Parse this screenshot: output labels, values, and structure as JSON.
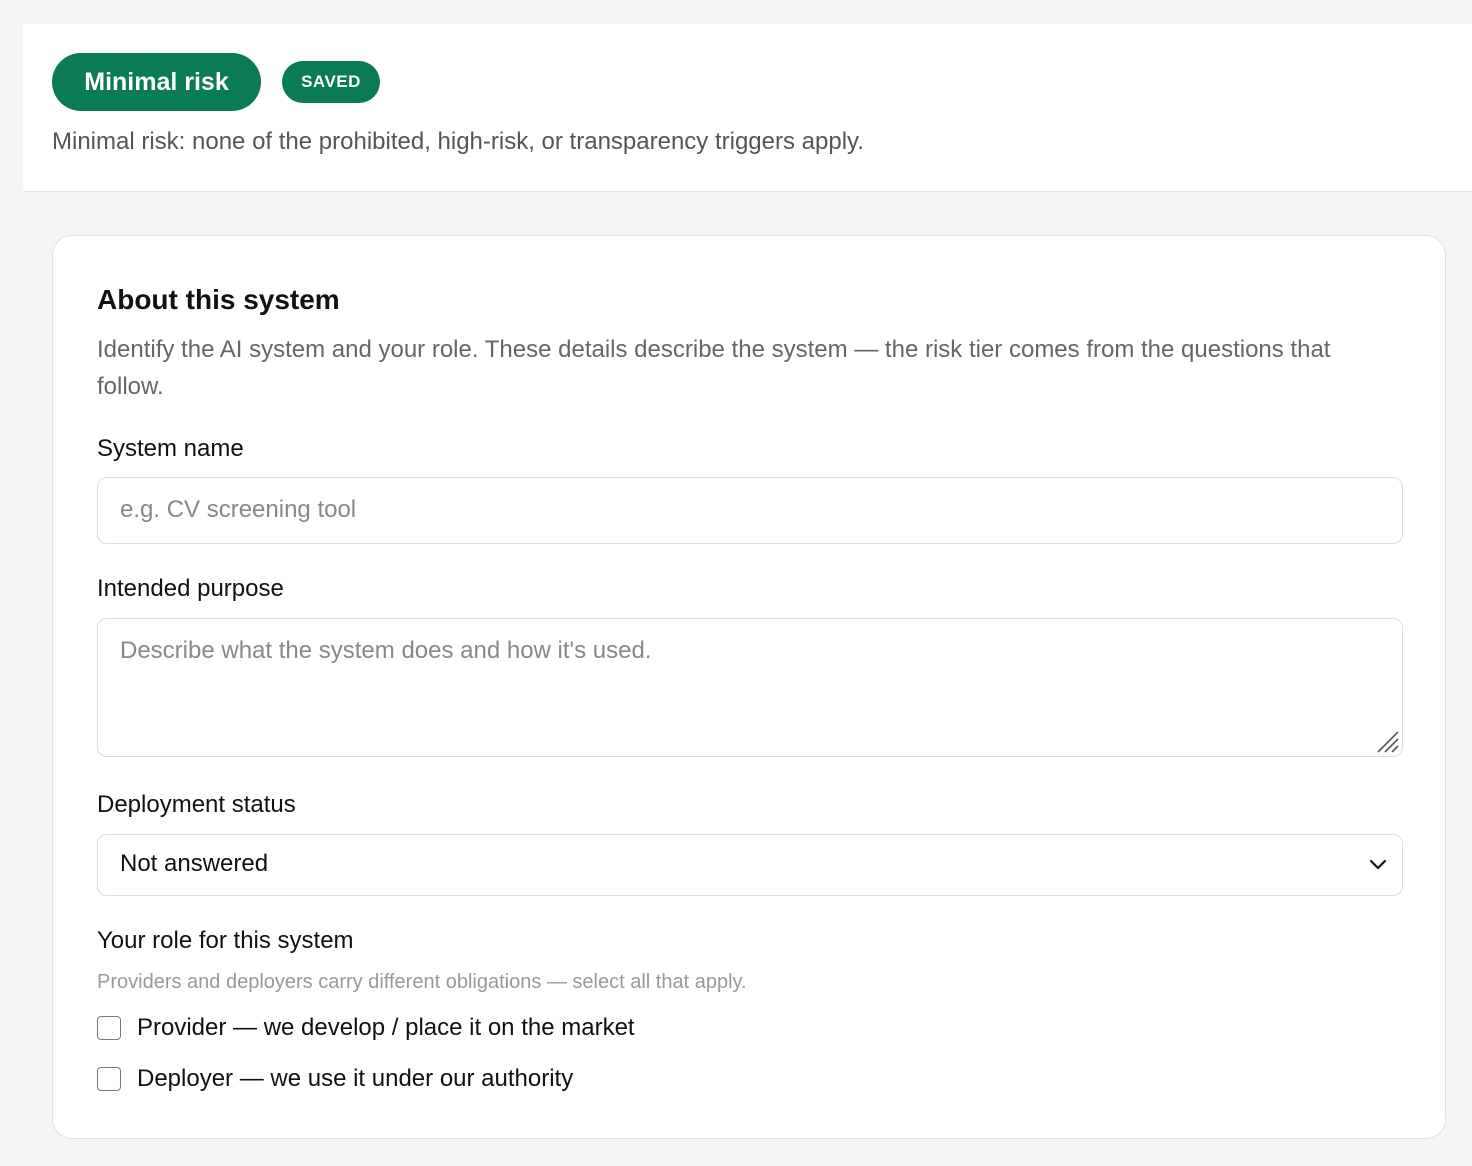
{
  "header": {
    "risk_label": "Minimal risk",
    "saved_badge": "SAVED",
    "risk_description": "Minimal risk: none of the prohibited, high-risk, or transparency triggers apply."
  },
  "card": {
    "title": "About this system",
    "description": "Identify the AI system and your role. These details describe the system — the risk tier comes from the questions that follow.",
    "system_name": {
      "label": "System name",
      "placeholder": "e.g. CV screening tool",
      "value": ""
    },
    "intended_purpose": {
      "label": "Intended purpose",
      "placeholder": "Describe what the system does and how it's used.",
      "value": ""
    },
    "deployment_status": {
      "label": "Deployment status",
      "selected": "Not answered",
      "icon": "chevron-down-icon"
    },
    "role": {
      "label": "Your role for this system",
      "hint": "Providers and deployers carry different obligations — select all that apply.",
      "options": [
        {
          "label": "Provider — we develop / place it on the market",
          "checked": false
        },
        {
          "label": "Deployer — we use it under our authority",
          "checked": false
        }
      ]
    }
  },
  "colors": {
    "accent": "#0b7a57",
    "background": "#f4f4f4",
    "card": "#ffffff"
  }
}
